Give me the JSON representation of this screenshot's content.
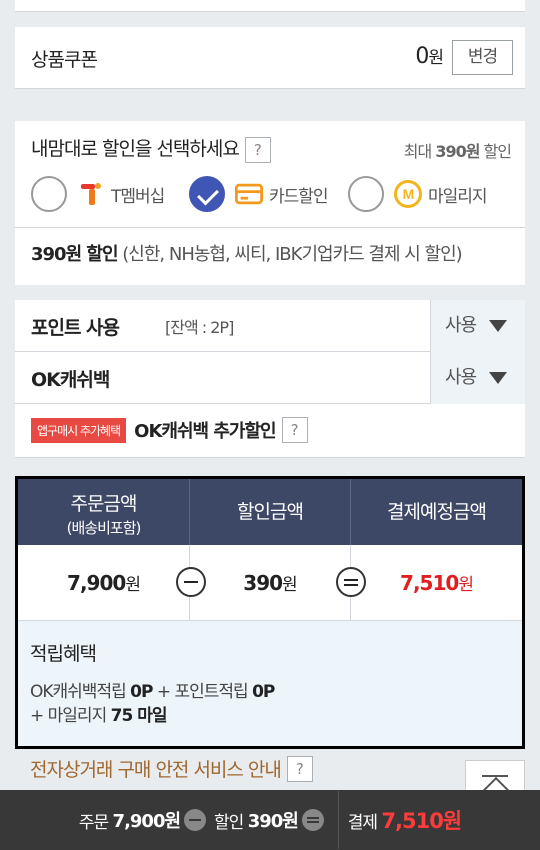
{
  "coupon": {
    "label": "상품쿠폰",
    "amount": "0",
    "unit": "원",
    "change_button": "변경"
  },
  "discount": {
    "title": "내맘대로 할인을 선택하세요",
    "help": "?",
    "max_prefix": "최대",
    "max_amount": "390원",
    "max_suffix": "할인",
    "options": [
      {
        "label": "T멤버십",
        "icon": "t-membership-icon",
        "selected": false
      },
      {
        "label": "카드할인",
        "icon": "card-icon",
        "selected": true
      },
      {
        "label": "마일리지",
        "icon": "mileage-icon",
        "selected": false
      }
    ],
    "desc_bold": "390원 할인",
    "desc_rest": "(신한, NH농협, 씨티, IBK기업카드 결제 시 할인)"
  },
  "points": {
    "point_label": "포인트 사용",
    "balance": "[잔액 : 2P]",
    "use_label": "사용",
    "ok_label": "OK캐쉬백",
    "ok_use_label": "사용",
    "badge": "앱구매시 추가혜택",
    "ok_extra": "OK캐쉬백 추가할인",
    "help": "?"
  },
  "summary": {
    "order_title": "주문금액",
    "order_sub": "(배송비포함)",
    "discount_title": "할인금액",
    "pay_title": "결제예정금액",
    "order_value": "7,900",
    "discount_value": "390",
    "pay_value": "7,510",
    "unit": "원",
    "accum_title": "적립혜택",
    "accum_line1_a": "OK캐쉬백적립 ",
    "accum_line1_b": "0P",
    "accum_line1_c": " + 포인트적립 ",
    "accum_line1_d": "0P",
    "accum_line2_a": "+ 마일리지 ",
    "accum_line2_b": "75 마일"
  },
  "safe_service": {
    "label": "전자상거래 구매 안전 서비스 안내",
    "help": "?"
  },
  "bottom_bar": {
    "order_label": "주문",
    "order_value": "7,900원",
    "discount_label": "할인",
    "discount_value": "390원",
    "pay_label": "결제",
    "pay_value": "7,510원"
  },
  "colors": {
    "accent_blue": "#3f56b5",
    "header_navy": "#3d4766",
    "price_red": "#e02020",
    "badge_red": "#e84a43"
  }
}
